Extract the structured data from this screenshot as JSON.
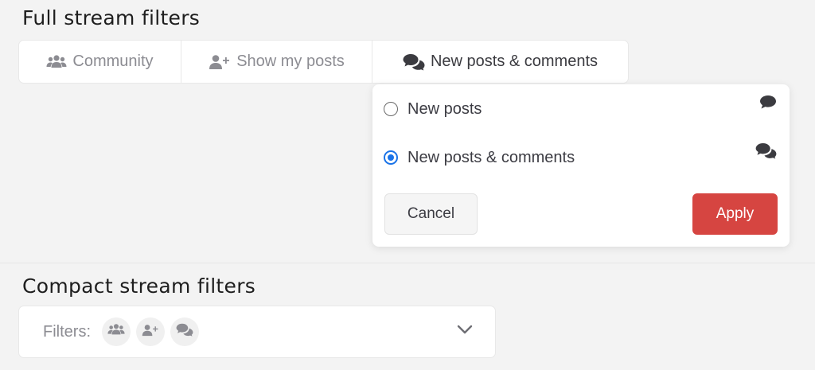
{
  "full": {
    "title": "Full stream filters",
    "tabs": [
      {
        "label": "Community",
        "icon": "users-icon",
        "active": false
      },
      {
        "label": "Show my posts",
        "icon": "user-plus-icon",
        "active": false
      },
      {
        "label": "New posts & comments",
        "icon": "comments-icon",
        "active": true
      }
    ]
  },
  "dropdown": {
    "options": [
      {
        "label": "New posts",
        "icon": "comment-icon",
        "selected": false
      },
      {
        "label": "New posts & comments",
        "icon": "comments-icon",
        "selected": true
      }
    ],
    "cancel_label": "Cancel",
    "apply_label": "Apply"
  },
  "compact": {
    "title": "Compact stream filters",
    "filters_label": "Filters:",
    "chips": [
      "users-icon",
      "user-plus-icon",
      "comments-icon"
    ]
  },
  "colors": {
    "accent_apply": "#d64541",
    "radio_selected": "#1a73e8",
    "icon_muted": "#8c8c92",
    "icon_dark": "#3b3b40"
  }
}
